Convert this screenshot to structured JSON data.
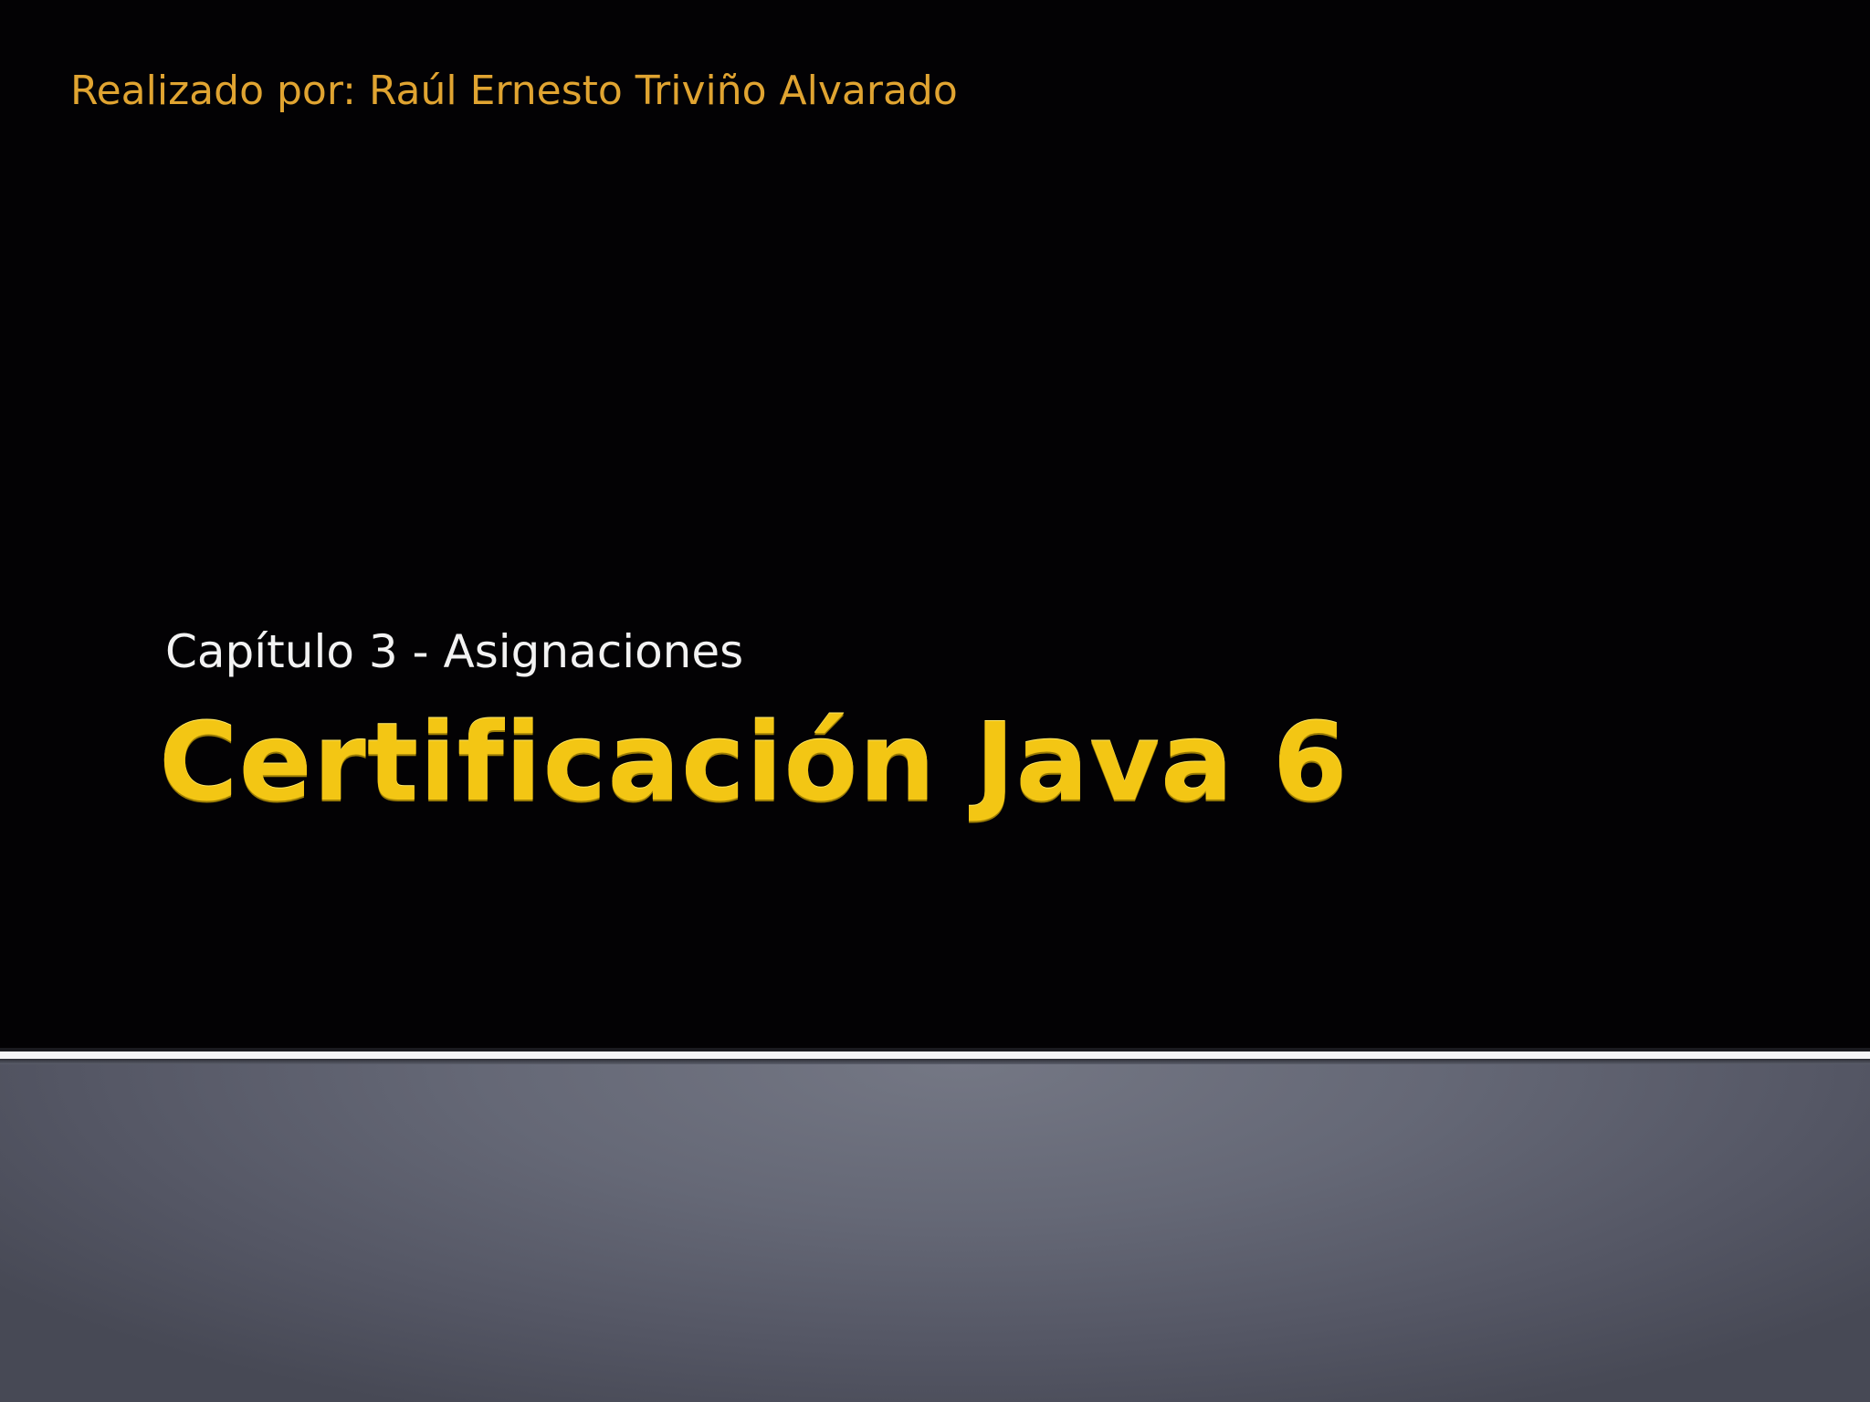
{
  "slide": {
    "author": "Realizado por: Raúl Ernesto Triviño Alvarado",
    "subtitle": "Capítulo 3 - Asignaciones",
    "title": "Certificación Java 6"
  },
  "colors": {
    "background": "#030204",
    "author_text": "#e0a431",
    "subtitle_text": "#f2f2f2",
    "title_text": "#f3c614",
    "divider": "#f4f4f6",
    "footer_panel": "#656876"
  }
}
